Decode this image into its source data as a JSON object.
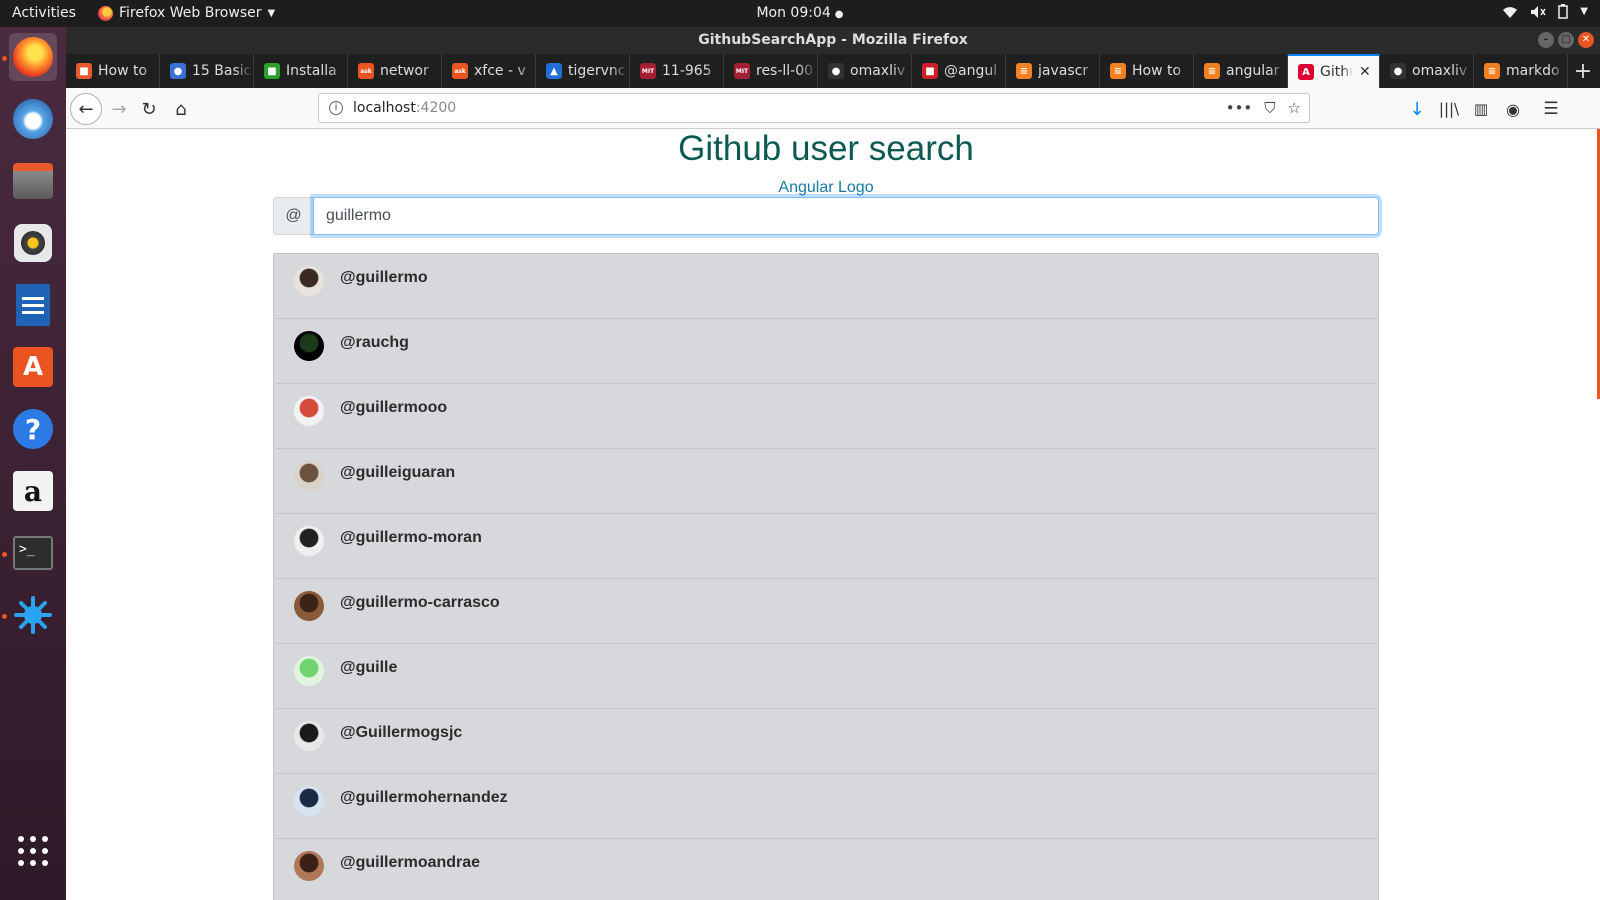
{
  "topbar": {
    "activities": "Activities",
    "app_menu": "Firefox Web Browser",
    "clock": "Mon 09:04"
  },
  "launcher": {
    "items": [
      {
        "name": "firefox-icon",
        "active": true
      },
      {
        "name": "thunderbird-icon"
      },
      {
        "name": "files-icon"
      },
      {
        "name": "rhythmbox-icon"
      },
      {
        "name": "writer-icon"
      },
      {
        "name": "software-center-icon"
      },
      {
        "name": "help-icon"
      },
      {
        "name": "amazon-icon"
      },
      {
        "name": "terminal-icon"
      },
      {
        "name": "settings-splash-icon"
      }
    ]
  },
  "window": {
    "title": "GithubSearchApp - Mozilla Firefox"
  },
  "tabs": [
    {
      "label": "How to",
      "color": "#e55b2d",
      "glyph": "■"
    },
    {
      "label": "15 Basic",
      "color": "#3b6fd6",
      "glyph": "●"
    },
    {
      "label": "Installa",
      "color": "#2aa22a",
      "glyph": "■"
    },
    {
      "label": "networ",
      "color": "#e95420",
      "glyph": "ask"
    },
    {
      "label": "xfce - v",
      "color": "#e95420",
      "glyph": "ask"
    },
    {
      "label": "tigervnc",
      "color": "#1f6fd6",
      "glyph": "▲"
    },
    {
      "label": "11-965",
      "color": "#a31f34",
      "glyph": "MIT"
    },
    {
      "label": "res-ll-00",
      "color": "#a31f34",
      "glyph": "MIT"
    },
    {
      "label": "omaxliv",
      "color": "#333333",
      "glyph": "●"
    },
    {
      "label": "@angul",
      "color": "#cc1f2a",
      "glyph": "■"
    },
    {
      "label": "javascr",
      "color": "#f48024",
      "glyph": "≡"
    },
    {
      "label": "How to",
      "color": "#f48024",
      "glyph": "≡"
    },
    {
      "label": "angular",
      "color": "#f48024",
      "glyph": "≡"
    },
    {
      "label": "Githu",
      "color": "#dd0031",
      "glyph": "A",
      "active": true
    },
    {
      "label": "omaxliv",
      "color": "#333333",
      "glyph": "●"
    },
    {
      "label": "markdo",
      "color": "#f48024",
      "glyph": "≡"
    }
  ],
  "url": {
    "host": "localhost",
    "port": ":4200"
  },
  "page": {
    "title": "Github user search",
    "logo_alt": "Angular Logo",
    "prepend": "@",
    "search_value": "guillermo"
  },
  "results": [
    {
      "username": "@guillermo",
      "avatar_colors": [
        "#e8e2dc",
        "#3b2a22"
      ]
    },
    {
      "username": "@rauchg",
      "avatar_colors": [
        "#000000",
        "#1a3a1a"
      ]
    },
    {
      "username": "@guillermooo",
      "avatar_colors": [
        "#f2f2f2",
        "#d24b3c"
      ]
    },
    {
      "username": "@guilleiguaran",
      "avatar_colors": [
        "#d8d2c8",
        "#6b5240"
      ]
    },
    {
      "username": "@guillermo-moran",
      "avatar_colors": [
        "#f0f0f0",
        "#222222"
      ]
    },
    {
      "username": "@guillermo-carrasco",
      "avatar_colors": [
        "#8a5a3a",
        "#3a2418"
      ]
    },
    {
      "username": "@guille",
      "avatar_colors": [
        "#dff5df",
        "#6fd36f"
      ]
    },
    {
      "username": "@Guillermogsjc",
      "avatar_colors": [
        "#e8e8e8",
        "#1a1a1a"
      ]
    },
    {
      "username": "@guillermohernandez",
      "avatar_colors": [
        "#d6e4f2",
        "#1c2a44"
      ]
    },
    {
      "username": "@guillermoandrae",
      "avatar_colors": [
        "#b07858",
        "#3a2016"
      ]
    }
  ]
}
